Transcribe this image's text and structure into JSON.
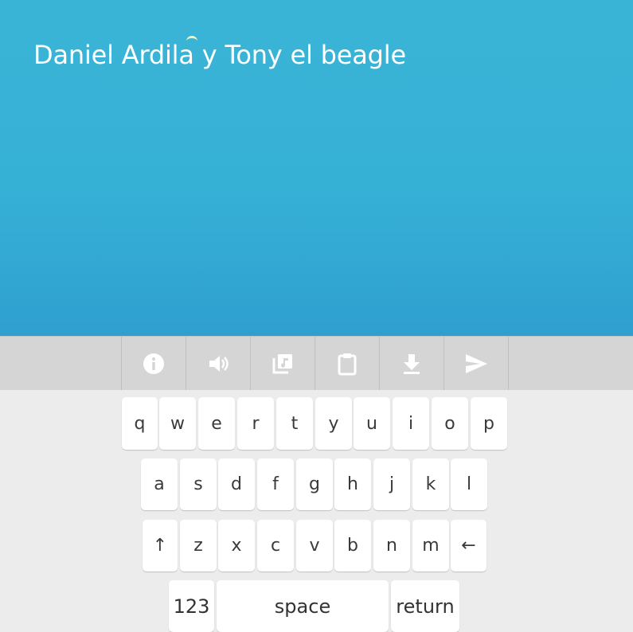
{
  "text": {
    "content": "Daniel Ardila y Tony el beagle"
  },
  "toolbar": {
    "icons": [
      "info-icon",
      "speaker-icon",
      "music-library-icon",
      "clipboard-icon",
      "download-icon",
      "send-icon"
    ]
  },
  "keyboard": {
    "row1": [
      "q",
      "w",
      "e",
      "r",
      "t",
      "y",
      "u",
      "i",
      "o",
      "p"
    ],
    "row2": [
      "a",
      "s",
      "d",
      "f",
      "g",
      "h",
      "j",
      "k",
      "l"
    ],
    "row3": [
      "z",
      "x",
      "c",
      "v",
      "b",
      "n",
      "m"
    ],
    "shift_symbol": "↑",
    "backspace_symbol": "←",
    "numbers_label": "123",
    "space_label": "space",
    "return_label": "return"
  },
  "colors": {
    "background_top": "#3ab4d6",
    "background_bottom": "#2f9fd0",
    "toolbar": "#d5d5d5",
    "keyboard": "#ececec",
    "icon": "#ffffff"
  }
}
